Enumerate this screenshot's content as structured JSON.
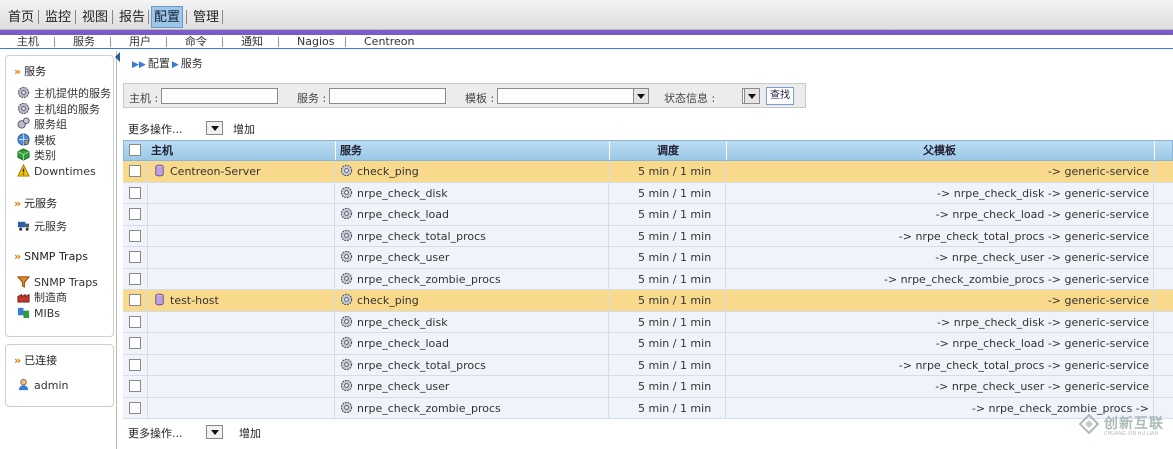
{
  "top_nav": [
    "首页",
    "监控",
    "视图",
    "报告",
    "配置",
    "管理"
  ],
  "top_nav_active": 4,
  "sub_nav": [
    "主机",
    "服务",
    "用户",
    "命令",
    "通知",
    "Nagios",
    "Centreon"
  ],
  "sidebar": {
    "services_title": "服务",
    "services_items": [
      {
        "label": "主机提供的服务",
        "icon": "gear-icon"
      },
      {
        "label": "主机组的服务",
        "icon": "gear-icon"
      },
      {
        "label": "服务组",
        "icon": "gears-icon"
      },
      {
        "label": "模板",
        "icon": "globe-icon"
      },
      {
        "label": "类别",
        "icon": "cube-icon"
      },
      {
        "label": "Downtimes",
        "icon": "warning-icon"
      }
    ],
    "meta_title": "元服务",
    "meta_items": [
      {
        "label": "元服务",
        "icon": "truck-icon"
      }
    ],
    "snmp_title": "SNMP Traps",
    "snmp_items": [
      {
        "label": "SNMP Traps",
        "icon": "funnel-icon"
      },
      {
        "label": "制造商",
        "icon": "factory-icon"
      },
      {
        "label": "MIBs",
        "icon": "mib-icon"
      }
    ],
    "connected_title": "已连接",
    "connected_user": "admin"
  },
  "breadcrumb": [
    "配置",
    "服务"
  ],
  "filter": {
    "host_label": "主机 :",
    "service_label": "服务 :",
    "template_label": "模板 :",
    "status_label": "状态信息 :",
    "search_label": "查找"
  },
  "actions": {
    "more_ops": "更多操作...",
    "add": "增加"
  },
  "table": {
    "headers": [
      "主机",
      "服务",
      "调度",
      "父模板"
    ],
    "rows": [
      {
        "type": "host",
        "host": "Centreon-Server",
        "service": "check_ping",
        "schedule": "5 min / 1 min",
        "parent": "-> generic-service"
      },
      {
        "type": "svc",
        "host": "",
        "service": "nrpe_check_disk",
        "schedule": "5 min / 1 min",
        "parent": "-> nrpe_check_disk -> generic-service"
      },
      {
        "type": "svc",
        "host": "",
        "service": "nrpe_check_load",
        "schedule": "5 min / 1 min",
        "parent": "-> nrpe_check_load -> generic-service"
      },
      {
        "type": "svc",
        "host": "",
        "service": "nrpe_check_total_procs",
        "schedule": "5 min / 1 min",
        "parent": "-> nrpe_check_total_procs -> generic-service"
      },
      {
        "type": "svc",
        "host": "",
        "service": "nrpe_check_user",
        "schedule": "5 min / 1 min",
        "parent": "-> nrpe_check_user -> generic-service"
      },
      {
        "type": "svc",
        "host": "",
        "service": "nrpe_check_zombie_procs",
        "schedule": "5 min / 1 min",
        "parent": "-> nrpe_check_zombie_procs -> generic-service"
      },
      {
        "type": "host",
        "host": "test-host",
        "service": "check_ping",
        "schedule": "5 min / 1 min",
        "parent": "-> generic-service"
      },
      {
        "type": "svc",
        "host": "",
        "service": "nrpe_check_disk",
        "schedule": "5 min / 1 min",
        "parent": "-> nrpe_check_disk -> generic-service"
      },
      {
        "type": "svc",
        "host": "",
        "service": "nrpe_check_load",
        "schedule": "5 min / 1 min",
        "parent": "-> nrpe_check_load -> generic-service"
      },
      {
        "type": "svc",
        "host": "",
        "service": "nrpe_check_total_procs",
        "schedule": "5 min / 1 min",
        "parent": "-> nrpe_check_total_procs -> generic-service"
      },
      {
        "type": "svc",
        "host": "",
        "service": "nrpe_check_user",
        "schedule": "5 min / 1 min",
        "parent": "-> nrpe_check_user -> generic-service"
      },
      {
        "type": "svc",
        "host": "",
        "service": "nrpe_check_zombie_procs",
        "schedule": "5 min / 1 min",
        "parent": "-> nrpe_check_zombie_procs ->"
      }
    ]
  },
  "watermark": {
    "text": "创新互联",
    "sub": "CHUANG XIN HU LIAN"
  },
  "colors": {
    "accent": "#7b5bc7",
    "host_row": "#f9d98b",
    "service_row": "#f0f4fa",
    "header": "#9ac8e8"
  }
}
